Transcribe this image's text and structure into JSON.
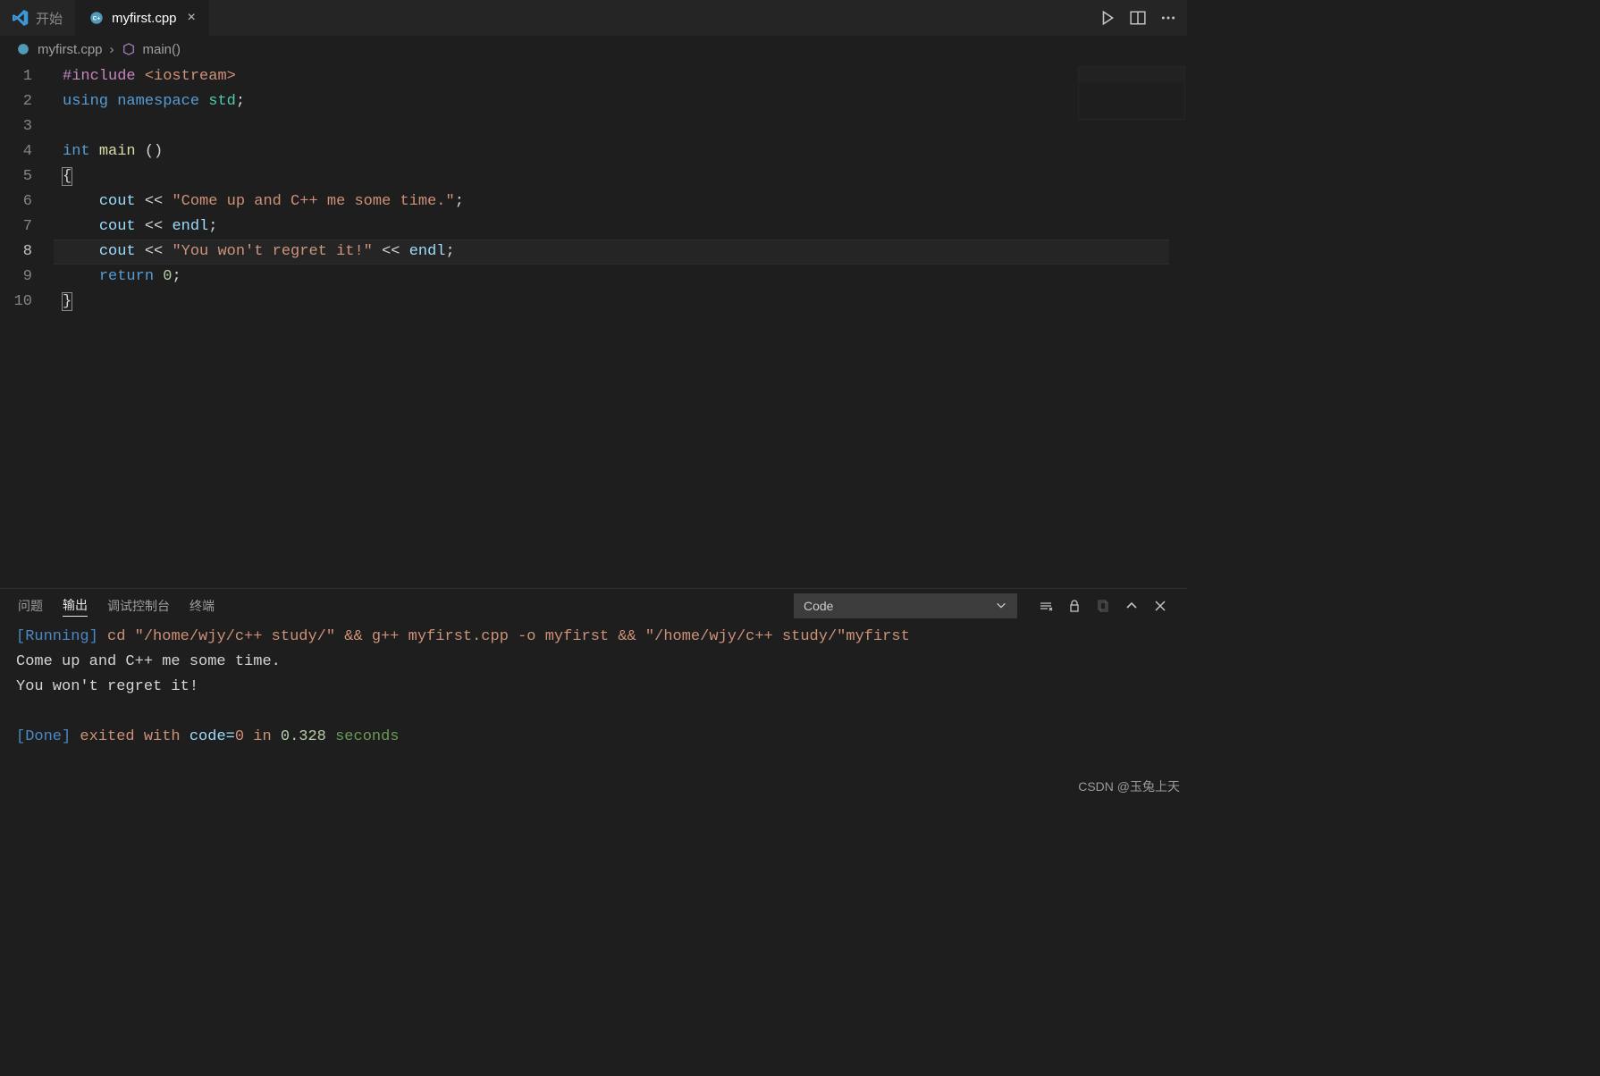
{
  "tabs": {
    "welcome": {
      "label": "开始"
    },
    "file": {
      "label": "myfirst.cpp"
    }
  },
  "breadcrumb": {
    "file": "myfirst.cpp",
    "symbol": "main()"
  },
  "editor": {
    "line_numbers": [
      "1",
      "2",
      "3",
      "4",
      "5",
      "6",
      "7",
      "8",
      "9",
      "10"
    ],
    "current_line_index": 7,
    "lines": [
      {
        "t": [
          [
            "dir",
            "#include"
          ],
          [
            "pun",
            " "
          ],
          [
            "inc",
            "<iostream>"
          ]
        ]
      },
      {
        "t": [
          [
            "kw",
            "using"
          ],
          [
            "pun",
            " "
          ],
          [
            "kw",
            "namespace"
          ],
          [
            "pun",
            " "
          ],
          [
            "ns",
            "std"
          ],
          [
            "pun",
            ";"
          ]
        ]
      },
      {
        "t": []
      },
      {
        "t": [
          [
            "kw",
            "int"
          ],
          [
            "pun",
            " "
          ],
          [
            "fn",
            "main"
          ],
          [
            "pun",
            " ()"
          ]
        ]
      },
      {
        "t": [
          [
            "pun",
            "{"
          ]
        ],
        "brace": true
      },
      {
        "t": [
          [
            "pun",
            "    "
          ],
          [
            "id",
            "cout"
          ],
          [
            "pun",
            " << "
          ],
          [
            "str",
            "\"Come up and C++ me some time.\""
          ],
          [
            "pun",
            ";"
          ]
        ]
      },
      {
        "t": [
          [
            "pun",
            "    "
          ],
          [
            "id",
            "cout"
          ],
          [
            "pun",
            " << "
          ],
          [
            "id",
            "endl"
          ],
          [
            "pun",
            ";"
          ]
        ]
      },
      {
        "t": [
          [
            "pun",
            "    "
          ],
          [
            "id",
            "cout"
          ],
          [
            "pun",
            " << "
          ],
          [
            "str",
            "\"You won't regret it!\""
          ],
          [
            "pun",
            " << "
          ],
          [
            "id",
            "endl"
          ],
          [
            "pun",
            ";"
          ]
        ]
      },
      {
        "t": [
          [
            "pun",
            "    "
          ],
          [
            "kw",
            "return"
          ],
          [
            "pun",
            " "
          ],
          [
            "num",
            "0"
          ],
          [
            "pun",
            ";"
          ]
        ]
      },
      {
        "t": [
          [
            "pun",
            "}"
          ]
        ],
        "brace": true
      }
    ]
  },
  "panel": {
    "tabs": {
      "problems": "问题",
      "output": "输出",
      "debug": "调试控制台",
      "terminal": "终端"
    },
    "task_selected": "Code",
    "output": {
      "running_tag": "[Running]",
      "command": " cd \"/home/wjy/c++ study/\" && g++ myfirst.cpp -o myfirst && \"/home/wjy/c++ study/\"myfirst",
      "stdout_line1": "Come up and C++ me some time.",
      "stdout_line2": "You won't regret it!",
      "done_tag": "[Done]",
      "done_text": " exited with ",
      "code_key": "code=",
      "code_val": "0",
      "in_text": " in ",
      "time_val": "0.328",
      "seconds": " seconds"
    }
  },
  "watermark": "CSDN @玉兔上天"
}
